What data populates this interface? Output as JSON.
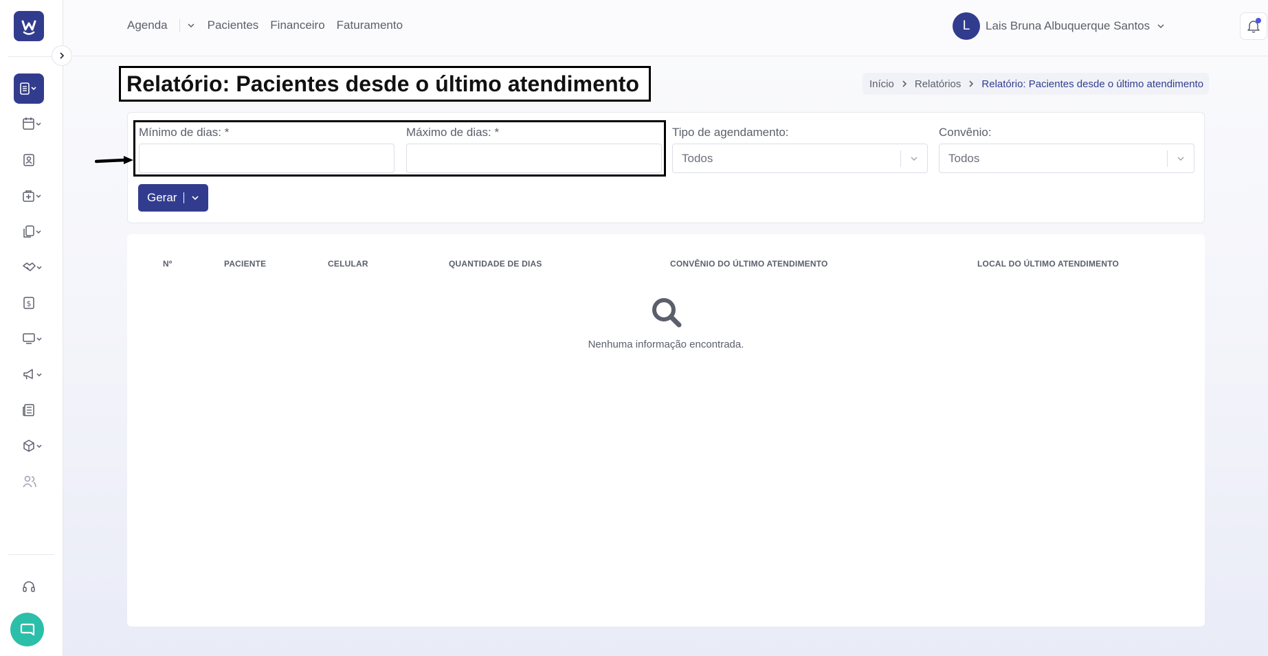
{
  "sidebar": {
    "logo_letter": "w",
    "items": [
      {
        "icon": "report-icon",
        "active": true
      },
      {
        "icon": "calendar-icon"
      },
      {
        "icon": "contact-card-icon"
      },
      {
        "icon": "medical-kit-icon"
      },
      {
        "icon": "documents-icon"
      },
      {
        "icon": "handshake-icon"
      },
      {
        "icon": "dollar-icon"
      },
      {
        "icon": "monitor-icon"
      },
      {
        "icon": "megaphone-icon"
      },
      {
        "icon": "newspaper-icon"
      },
      {
        "icon": "box-icon"
      },
      {
        "icon": "users-icon"
      }
    ],
    "support_icon": "headset-icon",
    "chat_icon": "chat-icon"
  },
  "topnav": {
    "agenda": "Agenda",
    "pacientes": "Pacientes",
    "financeiro": "Financeiro",
    "faturamento": "Faturamento"
  },
  "user": {
    "initial": "L",
    "name": "Lais Bruna Albuquerque Santos"
  },
  "page": {
    "title": "Relatório: Pacientes desde o último atendimento"
  },
  "breadcrumb": {
    "home": "Início",
    "reports": "Relatórios",
    "current": "Relatório: Pacientes desde o último atendimento"
  },
  "filters": {
    "min_days_label": "Mínimo de dias: *",
    "min_days_value": "",
    "max_days_label": "Máximo de dias: *",
    "max_days_value": "",
    "schedule_type_label": "Tipo de agendamento:",
    "schedule_type_value": "Todos",
    "insurance_label": "Convênio:",
    "insurance_value": "Todos",
    "generate_label": "Gerar"
  },
  "table": {
    "columns": [
      "Nº",
      "PACIENTE",
      "CELULAR",
      "QUANTIDADE DE DIAS",
      "CONVÊNIO DO ÚLTIMO ATENDIMENTO",
      "LOCAL DO ÚLTIMO ATENDIMENTO"
    ],
    "empty_message": "Nenhuma informação encontrada."
  },
  "colors": {
    "brand": "#323c8e",
    "chat": "#2bbfa9",
    "notification_dot": "#4f56d9"
  }
}
